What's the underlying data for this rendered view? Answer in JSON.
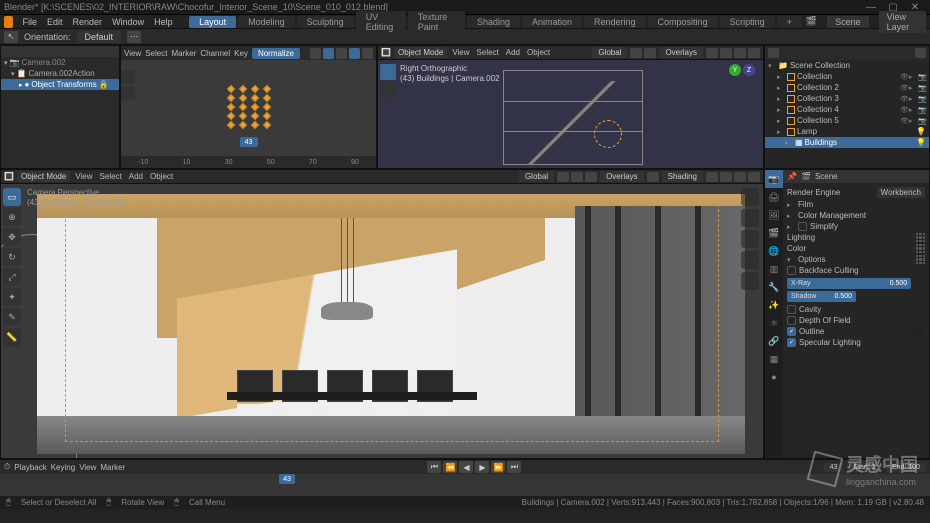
{
  "titlebar": {
    "title": "Blender* [K:\\SCENES\\02_INTERIOR\\RAW\\Chocofur_Interior_Scene_10\\Scene_010_012.blend]"
  },
  "menu": {
    "items": [
      "File",
      "Edit",
      "Render",
      "Window",
      "Help"
    ],
    "workspaces": [
      "Layout",
      "Modeling",
      "Sculpting",
      "UV Editing",
      "Texture Paint",
      "Shading",
      "Animation",
      "Rendering",
      "Compositing",
      "Scripting",
      "+"
    ],
    "scene": "Scene",
    "viewlayer": "View Layer"
  },
  "toolbar2": {
    "orientation": "Orientation:",
    "orientation_val": "Default",
    "snap_off": ""
  },
  "action_editor": {
    "header_items": [
      "View",
      "Select",
      "Marker",
      "Channel",
      "Key"
    ],
    "normalize": "Normalize",
    "items": [
      "Camera.002",
      "Camera.002Action",
      "Object Transforms"
    ],
    "ruler_ticks": [
      "-10",
      "10",
      "30",
      "43",
      "50",
      "70",
      "90"
    ],
    "current_frame": "43"
  },
  "ortho": {
    "mode": "Object Mode",
    "header_items": [
      "View",
      "Select",
      "Add",
      "Object"
    ],
    "global": "Global",
    "overlays": "Overlays",
    "label1": "Right Orthographic",
    "label2": "(43) Buildings | Camera.002"
  },
  "outliner": {
    "root": "Scene Collection",
    "items": [
      {
        "name": "Collection",
        "sel": false
      },
      {
        "name": "Collection 2",
        "sel": false
      },
      {
        "name": "Collection 3",
        "sel": false
      },
      {
        "name": "Collection 4",
        "sel": false
      },
      {
        "name": "Collection 5",
        "sel": false
      },
      {
        "name": "Lamp",
        "sel": false
      }
    ],
    "selected": "Buildings"
  },
  "mainview": {
    "mode": "Object Mode",
    "header_items": [
      "View",
      "Select",
      "Add",
      "Object"
    ],
    "global": "Global",
    "overlays": "Overlays",
    "shading": "Shading",
    "label1": "Camera Perspective",
    "label2": "(43) Buildings | Camera.002"
  },
  "properties": {
    "scene": "Scene",
    "engine_label": "Render Engine",
    "engine": "Workbench",
    "panels": [
      "Film",
      "Color Management",
      "Simplify"
    ],
    "panel_lighting": "Lighting",
    "panel_color": "Color",
    "panel_options": "Options",
    "options": {
      "backface": "Backface Culling",
      "xray": "X-Ray",
      "shadow": "Shadow",
      "shadow_val": "0.500",
      "cavity": "Cavity",
      "dof": "Depth Of Field",
      "outline": "Outline",
      "specular": "Specular Lighting"
    }
  },
  "timeline": {
    "header_items": [
      "Playback",
      "Keying",
      "View",
      "Marker"
    ],
    "frame": "43",
    "start_label": "Start:",
    "start": "1",
    "end_label": "End:",
    "end": "100"
  },
  "statusbar": {
    "left1": "Select or Deselect All",
    "left2": "Rotate View",
    "left3": "Call Menu",
    "right": "Buildings | Camera.002 | Verts:913,443 | Faces:900,803 | Tris:1,782,858 | Objects:1/96 | Mem: 1.19 GB | v2.80.48"
  },
  "watermark": {
    "main": "灵感中国",
    "sub": "lingganchina.com"
  }
}
